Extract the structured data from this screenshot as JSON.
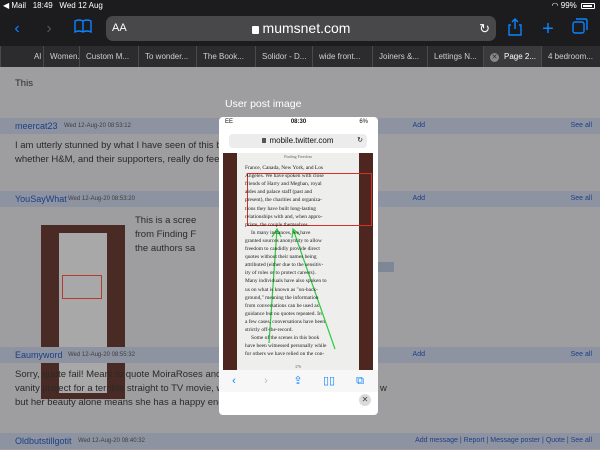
{
  "status_bar": {
    "back_app": "◀ Mail",
    "time": "18:49",
    "date": "Wed 12 Aug",
    "battery": "99%"
  },
  "browser": {
    "text_size_label": "AA",
    "url": "mumsnet.com",
    "tabs": [
      {
        "label": "Al"
      },
      {
        "label": "Women..."
      },
      {
        "label": "Custom M..."
      },
      {
        "label": "To wonder..."
      },
      {
        "label": "The Book..."
      },
      {
        "label": "Solidor - D..."
      },
      {
        "label": "wide front..."
      },
      {
        "label": "Joiners &..."
      },
      {
        "label": "Lettings N..."
      },
      {
        "label": "Page 2..."
      },
      {
        "label": "4 bedroom..."
      }
    ]
  },
  "page": {
    "top_text": "This",
    "posts": [
      {
        "user": "meercat23",
        "date": "Wed 12-Aug-20 08:53:12",
        "action": "Add",
        "lines": [
          "I am utterly stunned by what I have seen of this book",
          "whether H&M, and their supporters, really do feel th"
        ]
      },
      {
        "user": "YouSayWhat",
        "date": "Wed 12-Aug-20 08:53:20",
        "action": "Add",
        "lines": [
          "This is a scree",
          "from Finding F",
          "the authors sa"
        ]
      },
      {
        "user": "Eaumyword",
        "date": "Wed 12-Aug-20 08:55:32",
        "action": "Add",
        "lines": [
          "Sorry, quote fail! Meant to quote MoiraRoses and ag",
          "vanity project for a terrible straight to TV movie, whe",
          "but her beauty alone means she has a happy ending"
        ]
      },
      {
        "user": "Oldbutstillgotit",
        "date": "Wed 12-Aug-20 08:40:32",
        "action": "Add message | Report | Message poster | Quote | See all",
        "lines": []
      }
    ],
    "right_fragments": [
      "See all",
      "See all",
      "See all",
      "w"
    ]
  },
  "overlay": {
    "title": "User post image",
    "phone": {
      "carrier": "EE",
      "time": "08:30",
      "battery": "6%",
      "url": "mobile.twitter.com",
      "book_header": "Finding Freedom",
      "book_lines": [
        "France, Canada, New York, and Los",
        "Angeles. We have spoken with close",
        "friends of Harry and Meghan, royal",
        "aides and palace staff (past and",
        "present), the charities and organiza-",
        "tions they have built long-lasting",
        "relationships with and, when appro-",
        "priate, the couple themselves.",
        "In many instances, we have",
        "granted sources anonymity to allow",
        "freedom to candidly provide direct",
        "quotes without their names being",
        "attributed (either due to the sensitiv-",
        "ity of roles or to protect careers).",
        "Many individuals have also spoken to",
        "us on what is known as \"on-back-",
        "ground,\" meaning the information",
        "from conversations can be used as",
        "guidance but no quotes repeated. In",
        "a few cases, conversations have been",
        "strictly off-the-record.",
        "Some of the scenes in this book",
        "have been witnessed personally while",
        "for others we have relied on the con-"
      ],
      "book_page_number": "376",
      "highlight_color": "#d93025",
      "arrow_color": "#2ecc40"
    }
  }
}
